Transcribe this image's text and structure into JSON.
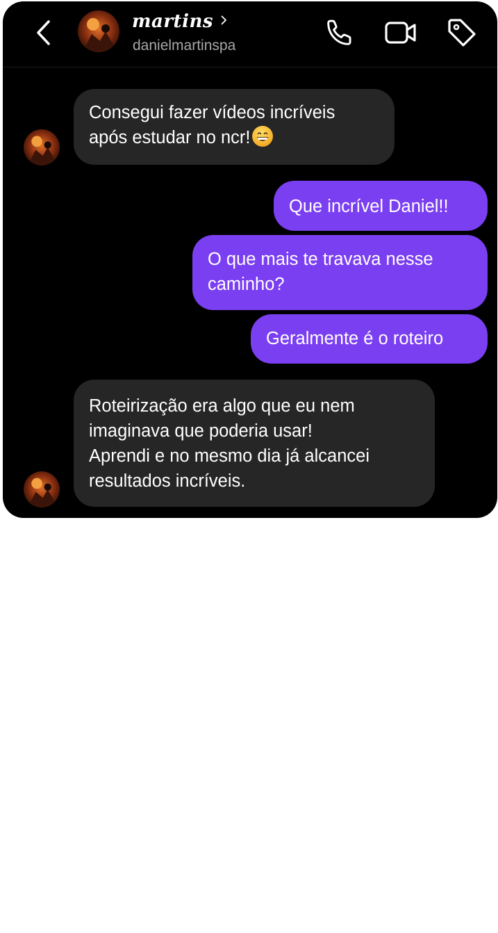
{
  "header": {
    "name": "martins",
    "username": "danielmartinspa"
  },
  "icons": {
    "back": "back-chevron-icon",
    "profile_chevron": "chevron-right-icon",
    "call": "phone-call-icon",
    "video": "video-call-icon",
    "tag": "tag-icon"
  },
  "messages": [
    {
      "direction": "incoming",
      "text": "Consegui fazer vídeos incríveis",
      "text2": "após estudar no ncr!",
      "emoji": "grinning-face-icon"
    },
    {
      "direction": "outgoing",
      "text": "Que incrível Daniel!!"
    },
    {
      "direction": "outgoing",
      "text": "O que mais te travava nesse",
      "text2": "caminho?"
    },
    {
      "direction": "outgoing",
      "text": "Geralmente é o roteiro"
    },
    {
      "direction": "incoming",
      "lines": [
        "Roteirização era algo que eu nem",
        "imaginava que poderia usar!",
        "Aprendi e no mesmo dia já alcancei",
        "resultados incríveis."
      ]
    }
  ],
  "colors": {
    "background": "#000000",
    "incoming_bubble": "#262626",
    "outgoing_bubble": "#7b3ff2",
    "text": "#ffffff",
    "username": "#a8a8a8"
  }
}
